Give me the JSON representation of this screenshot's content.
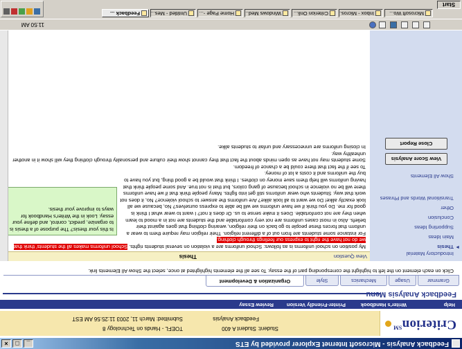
{
  "window": {
    "title": "Feedback Analysis - Microsoft Internet Explorer provided by ETS",
    "buttons": [
      "_",
      "□",
      "×"
    ]
  },
  "header": {
    "logo_text": "Criterion",
    "logo_mark": "SM",
    "info": {
      "student_label": "Student: Student A 400",
      "course": "TOEFL - Hands on Technology 8",
      "submitted": "Submitted: March 11, 2003 11:25:56 AM EST",
      "date": "Feedback Analysis"
    },
    "colors": {
      "brand": "#22308a",
      "band": "#f6e7ad",
      "nav": "#2a3a8c"
    }
  },
  "nav": {
    "links": [
      "Review Essay",
      "Printer-Friendly Version",
      "Writer's Handbook",
      "Help"
    ]
  },
  "menu": {
    "title": "Feedback Analysis Menu",
    "tabs": [
      "Grammar",
      "Usage",
      "Mechanics",
      "Style",
      "Organization & Development"
    ],
    "active_tab": "Organization & Development",
    "instructions": "Click on each element on the left to highlight the corresponding part of the essay. To see all the elements highlighted at once, select the Show All Elements link."
  },
  "sidebar": {
    "items": [
      "Introductory Material",
      "Thesis",
      "Main Ideas",
      "Supporting Ideas",
      "Conclusion",
      "Other",
      "Transitional Words and Phrases",
      "Show All Elements"
    ],
    "current": "Thesis",
    "buttons": [
      "View Score Analysis",
      "Close Report"
    ]
  },
  "content": {
    "view_question": "View Question",
    "section_title": "Thesis",
    "para1_pre": "My position on school uniforms is as follows: School uniforms are a violation on several students rights. ",
    "para1_hl": "School uniforms makes all the students' think that we do not have the right to express our feelings through clothing.",
    "para2": "For instance some students are from out of a different religion. Their religion may require them to wear a uniform that forces these people to go back on their religion, wearing clothing that goes against their beliefs. Also in most cases uniforms are not very comfortable and the students are not in a mood to learn when they are not comfortable. Does it make sense to us. Or does it not? I want to wear what I think is good for me. Do you think if we have uniforms we will be able to express ourselves? No, because we all look exactly alike! Do we want to all look alike? Are uniforms the answer to school violence? No, it does not work that way. Students who wear uniforms still get into fights. Many people think that if we have uniforms there will be no violence in school because of gang colors, but that is not true. And some people think that having uniforms will help them save money on clothes. I think that would be a good thing, but you have to buy the uniforms and it costs a lot of money.",
    "para3": "To see if the fact that there could be a chance of freedom.",
    "para4": "Some students may not have as open minds about the fact that they cannot show their culture and personality through clothing they will show it in another unhealthy way.",
    "para5": "In closing uniforms are unnecessary and unfair to students alike.",
    "popup": "Is this your thesis? The purpose of a thesis is to organize, predict, control, and define your essay. Look in the Writer's Handbook for ways to improve your thesis.",
    "highlight_color": "#e00000",
    "popup_color": "#d9f7c8"
  },
  "toolbar": {
    "icons": [
      "back-icon",
      "forward-icon",
      "refresh-icon",
      "home-icon",
      "favorites-icon",
      "media-icon"
    ],
    "clock": "11:50 AM"
  },
  "taskbar": {
    "start_label": "Start",
    "tasks": [
      "Microsoft Wo...",
      "Inbox - Micros...",
      "Criterion Onli...",
      "Windows Med...",
      "Home Page -...",
      "Untitled - Mes...",
      "Feedback ..."
    ],
    "active_task": "Feedback ..."
  }
}
